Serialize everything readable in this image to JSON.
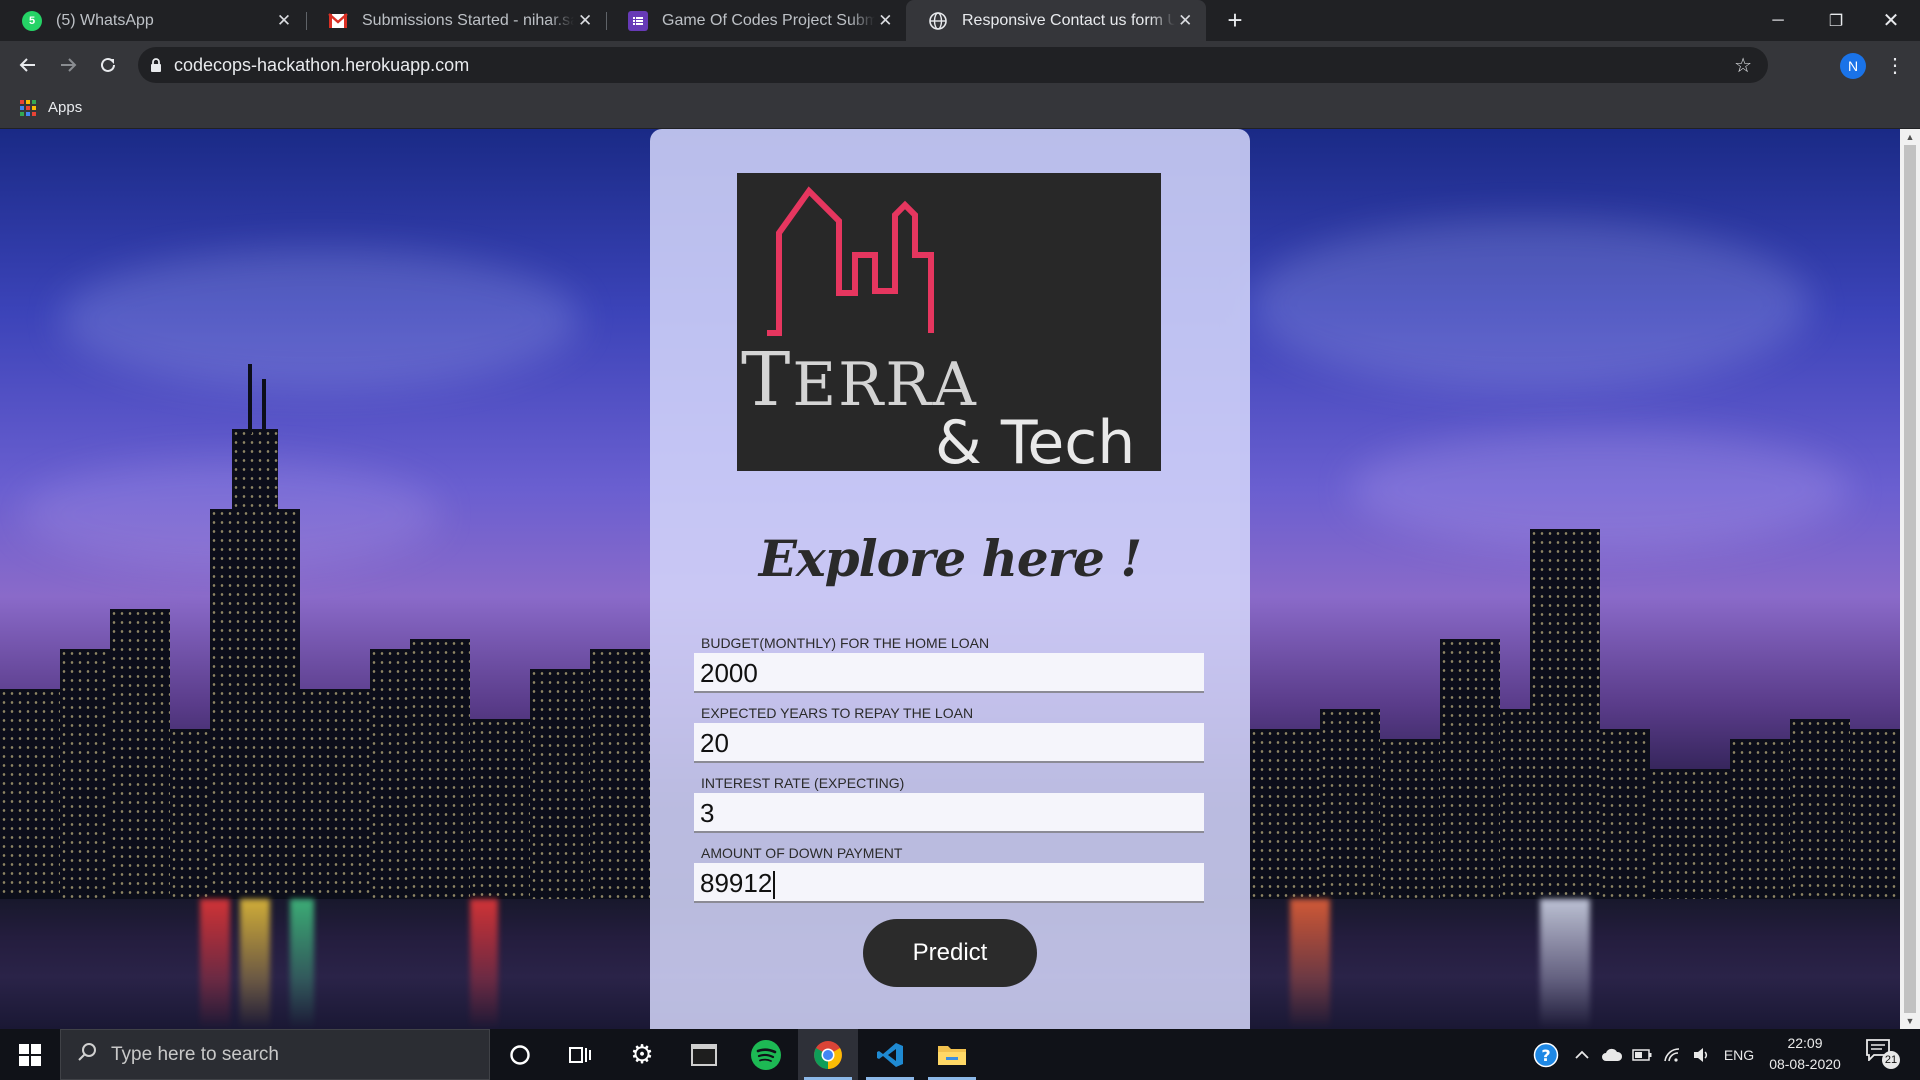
{
  "browser": {
    "tabs": [
      {
        "title": "(5) WhatsApp",
        "icon": "whatsapp-icon",
        "active": false
      },
      {
        "title": "Submissions Started - nihar.sand",
        "icon": "gmail-icon",
        "active": false
      },
      {
        "title": "Game Of Codes Project Submissi",
        "icon": "forms-icon",
        "active": false
      },
      {
        "title": "Responsive Contact us form Usin",
        "icon": "globe-icon",
        "active": true
      }
    ],
    "url": "codecops-hackathon.herokuapp.com",
    "profile_initial": "N",
    "bookmarks": {
      "apps_label": "Apps"
    }
  },
  "page": {
    "logo": {
      "word1": "Terra",
      "word2": "& Tech"
    },
    "headline": "Explore here !",
    "fields": [
      {
        "label": "BUDGET(MONTHLY) FOR THE HOME LOAN",
        "value": "2000"
      },
      {
        "label": "EXPECTED YEARS TO REPAY THE LOAN",
        "value": "20"
      },
      {
        "label": "INTEREST RATE (EXPECTING)",
        "value": "3"
      },
      {
        "label": "AMOUNT OF DOWN PAYMENT",
        "value": "89912"
      }
    ],
    "predict_label": "Predict"
  },
  "taskbar": {
    "search_placeholder": "Type here to search",
    "language": "ENG",
    "time": "22:09",
    "date": "08-08-2020",
    "notifications": "21"
  },
  "colors": {
    "logo_pink": "#e6365f",
    "logo_text": "#d4d4d4",
    "card": "#d4d6fa",
    "button": "#2b2b2b"
  }
}
